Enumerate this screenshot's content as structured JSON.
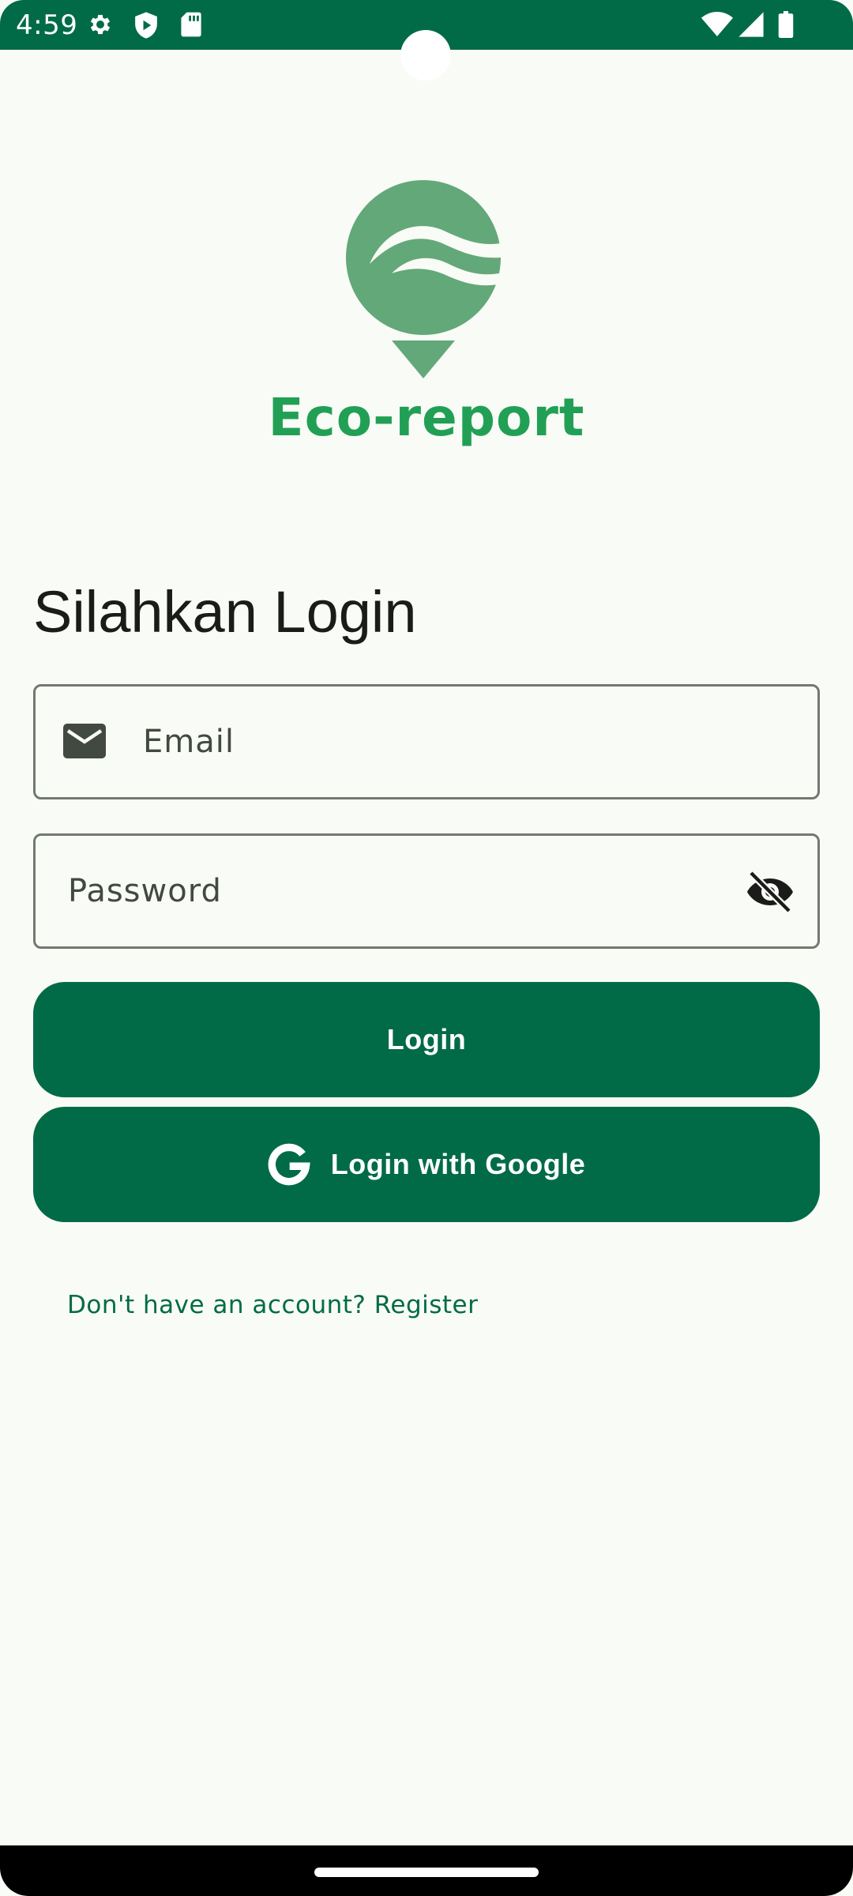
{
  "status_bar": {
    "time": "4:59",
    "left_icons": [
      "gear-icon",
      "shield-play-icon",
      "sd-card-icon"
    ],
    "right_icons": [
      "wifi-icon",
      "cell-signal-icon",
      "battery-icon"
    ]
  },
  "brand": {
    "name": "Eco-report",
    "color": "#21a055",
    "logo_color": "#63a879"
  },
  "login": {
    "heading": "Silahkan Login",
    "email_placeholder": "Email",
    "password_placeholder": "Password",
    "login_button": "Login",
    "google_button": "Login with Google",
    "register_link": "Don't have an account? Register"
  },
  "colors": {
    "primary": "#016b48",
    "background": "#f9fbf6",
    "outline": "#727970"
  }
}
